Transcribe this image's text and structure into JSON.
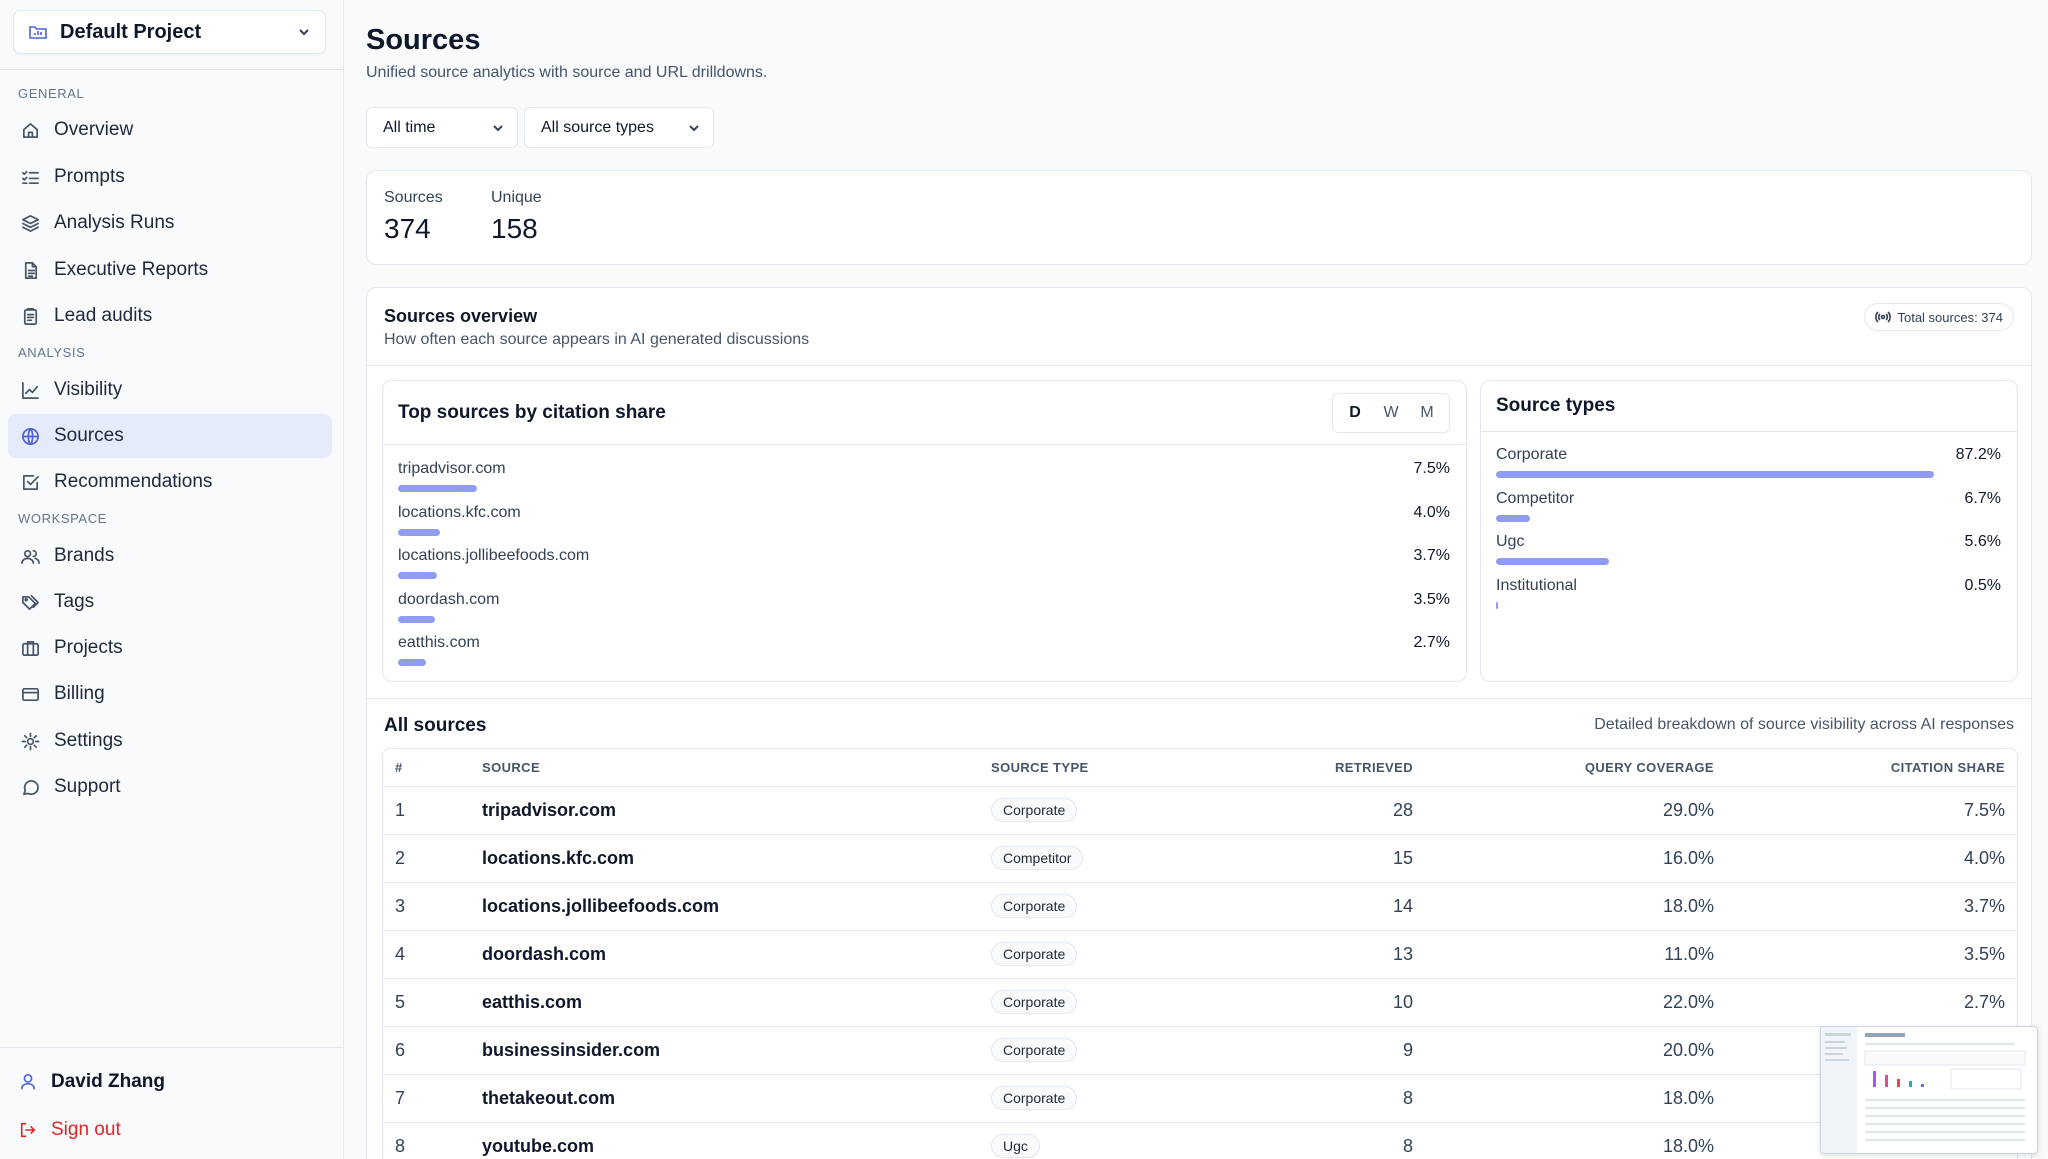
{
  "sidebar": {
    "project": "Default Project",
    "groups": {
      "general": "GENERAL",
      "analysis": "ANALYSIS",
      "workspace": "WORKSPACE"
    },
    "items": {
      "overview": "Overview",
      "prompts": "Prompts",
      "analysis_runs": "Analysis Runs",
      "executive_reports": "Executive Reports",
      "lead_audits": "Lead audits",
      "visibility": "Visibility",
      "sources": "Sources",
      "recommendations": "Recommendations",
      "brands": "Brands",
      "tags": "Tags",
      "projects": "Projects",
      "billing": "Billing",
      "settings": "Settings",
      "support": "Support"
    },
    "active": "sources",
    "user": "David Zhang",
    "sign_out": "Sign out"
  },
  "page": {
    "title": "Sources",
    "subtitle": "Unified source analytics with source and URL drilldowns."
  },
  "filters": {
    "time": "All time",
    "source_type": "All source types"
  },
  "stats": {
    "sources_label": "Sources",
    "sources_value": "374",
    "unique_label": "Unique",
    "unique_value": "158"
  },
  "overview": {
    "title": "Sources overview",
    "subtitle": "How often each source appears in AI generated discussions",
    "total_badge": "Total sources: 374"
  },
  "top_sources": {
    "title": "Top sources by citation share",
    "periods": [
      "D",
      "W",
      "M"
    ],
    "selected_period": "D",
    "items": [
      {
        "name": "tripadvisor.com",
        "pct": "7.5%",
        "value": 7.5
      },
      {
        "name": "locations.kfc.com",
        "pct": "4.0%",
        "value": 4.0
      },
      {
        "name": "locations.jollibeefoods.com",
        "pct": "3.7%",
        "value": 3.7
      },
      {
        "name": "doordash.com",
        "pct": "3.5%",
        "value": 3.5
      },
      {
        "name": "eatthis.com",
        "pct": "2.7%",
        "value": 2.7
      }
    ]
  },
  "source_types": {
    "title": "Source types",
    "items": [
      {
        "name": "Corporate",
        "pct": "87.2%",
        "value": 87.2
      },
      {
        "name": "Competitor",
        "pct": "6.7%",
        "value": 6.7
      },
      {
        "name": "Ugc",
        "pct": "5.6%",
        "value": 5.6
      },
      {
        "name": "Institutional",
        "pct": "0.5%",
        "value": 0.5
      }
    ]
  },
  "all_sources": {
    "title": "All sources",
    "subtitle": "Detailed breakdown of source visibility across AI responses",
    "columns": {
      "num": "#",
      "source": "SOURCE",
      "type": "SOURCE TYPE",
      "retrieved": "RETRIEVED",
      "coverage": "QUERY COVERAGE",
      "share": "CITATION SHARE"
    },
    "rows": [
      {
        "num": "1",
        "source": "tripadvisor.com",
        "type": "Corporate",
        "retrieved": "28",
        "coverage": "29.0%",
        "share": "7.5%"
      },
      {
        "num": "2",
        "source": "locations.kfc.com",
        "type": "Competitor",
        "retrieved": "15",
        "coverage": "16.0%",
        "share": "4.0%"
      },
      {
        "num": "3",
        "source": "locations.jollibeefoods.com",
        "type": "Corporate",
        "retrieved": "14",
        "coverage": "18.0%",
        "share": "3.7%"
      },
      {
        "num": "4",
        "source": "doordash.com",
        "type": "Corporate",
        "retrieved": "13",
        "coverage": "11.0%",
        "share": "3.5%"
      },
      {
        "num": "5",
        "source": "eatthis.com",
        "type": "Corporate",
        "retrieved": "10",
        "coverage": "22.0%",
        "share": "2.7%"
      },
      {
        "num": "6",
        "source": "businessinsider.com",
        "type": "Corporate",
        "retrieved": "9",
        "coverage": "20.0%",
        "share": ""
      },
      {
        "num": "7",
        "source": "thetakeout.com",
        "type": "Corporate",
        "retrieved": "8",
        "coverage": "18.0%",
        "share": ""
      },
      {
        "num": "8",
        "source": "youtube.com",
        "type": "Ugc",
        "retrieved": "8",
        "coverage": "18.0%",
        "share": ""
      }
    ]
  },
  "colors": {
    "accent": "#4f63d2",
    "bar": "#8f9cf0",
    "active_bg": "#e5ebfb",
    "danger": "#dc2626"
  }
}
